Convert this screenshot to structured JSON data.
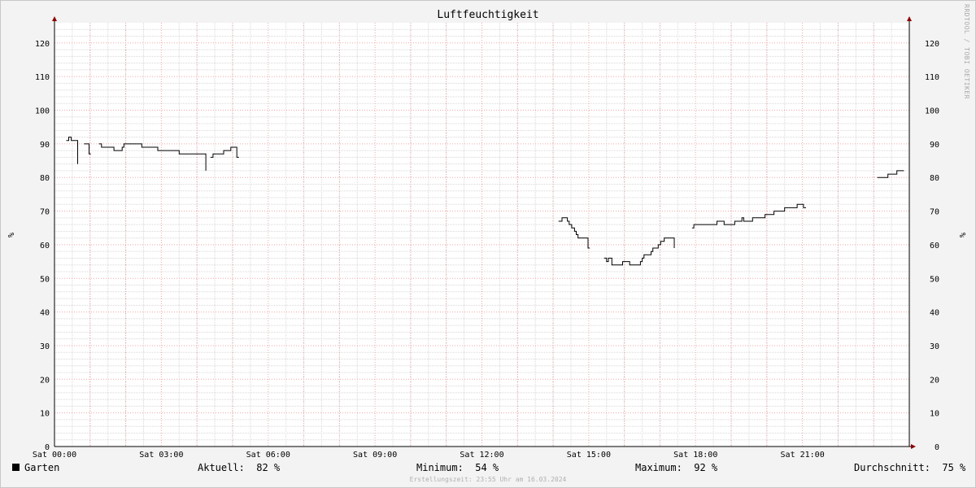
{
  "chart_data": {
    "type": "line",
    "title": "Luftfeuchtigkeit",
    "ylabel": "%",
    "ylim": [
      0,
      126
    ],
    "y_ticks": [
      0,
      10,
      20,
      30,
      40,
      50,
      60,
      70,
      80,
      90,
      100,
      110,
      120
    ],
    "x_range_hours": [
      0,
      24
    ],
    "x_ticks": [
      {
        "hour": 0,
        "label": "Sat 00:00"
      },
      {
        "hour": 3,
        "label": "Sat 03:00"
      },
      {
        "hour": 6,
        "label": "Sat 06:00"
      },
      {
        "hour": 9,
        "label": "Sat 09:00"
      },
      {
        "hour": 12,
        "label": "Sat 12:00"
      },
      {
        "hour": 15,
        "label": "Sat 15:00"
      },
      {
        "hour": 18,
        "label": "Sat 18:00"
      },
      {
        "hour": 21,
        "label": "Sat 21:00"
      }
    ],
    "grid": true,
    "series": [
      {
        "name": "Garten",
        "color": "#000000",
        "segments": [
          [
            [
              0.33,
              91
            ],
            [
              0.4,
              92
            ],
            [
              0.47,
              91
            ],
            [
              0.6,
              91
            ],
            [
              0.65,
              84
            ]
          ],
          [
            [
              0.83,
              90
            ],
            [
              0.93,
              90
            ],
            [
              0.97,
              87
            ],
            [
              1.02,
              87
            ]
          ],
          [
            [
              1.25,
              90
            ],
            [
              1.32,
              89
            ],
            [
              1.62,
              89
            ],
            [
              1.67,
              88
            ],
            [
              1.83,
              88
            ],
            [
              1.9,
              89
            ],
            [
              1.95,
              90
            ],
            [
              2.4,
              90
            ],
            [
              2.45,
              89
            ],
            [
              2.85,
              89
            ],
            [
              2.9,
              88
            ],
            [
              3.4,
              88
            ],
            [
              3.5,
              87
            ],
            [
              4.0,
              87
            ],
            [
              4.22,
              87
            ],
            [
              4.25,
              82
            ]
          ],
          [
            [
              4.38,
              86
            ],
            [
              4.45,
              87
            ],
            [
              4.7,
              87
            ],
            [
              4.75,
              88
            ],
            [
              4.9,
              88
            ],
            [
              4.95,
              89
            ],
            [
              5.05,
              89
            ],
            [
              5.12,
              86
            ],
            [
              5.18,
              86
            ]
          ],
          [
            [
              14.15,
              67
            ],
            [
              14.25,
              68
            ],
            [
              14.33,
              68
            ],
            [
              14.4,
              67
            ],
            [
              14.45,
              66
            ],
            [
              14.52,
              65
            ],
            [
              14.6,
              64
            ],
            [
              14.65,
              63
            ],
            [
              14.7,
              62
            ],
            [
              14.95,
              62
            ],
            [
              14.98,
              59
            ],
            [
              15.03,
              59
            ]
          ],
          [
            [
              15.43,
              56
            ],
            [
              15.5,
              55
            ],
            [
              15.55,
              56
            ],
            [
              15.62,
              56
            ],
            [
              15.65,
              54
            ],
            [
              15.75,
              54
            ],
            [
              15.85,
              54
            ],
            [
              15.95,
              55
            ],
            [
              16.1,
              55
            ],
            [
              16.15,
              54
            ],
            [
              16.35,
              54
            ],
            [
              16.45,
              55
            ],
            [
              16.5,
              56
            ],
            [
              16.55,
              57
            ],
            [
              16.7,
              57
            ],
            [
              16.75,
              58
            ],
            [
              16.8,
              59
            ],
            [
              16.9,
              59
            ],
            [
              16.95,
              60
            ],
            [
              17.02,
              61
            ],
            [
              17.12,
              62
            ],
            [
              17.38,
              62
            ],
            [
              17.4,
              59
            ]
          ],
          [
            [
              17.9,
              65
            ],
            [
              17.95,
              66
            ],
            [
              18.55,
              66
            ],
            [
              18.6,
              67
            ],
            [
              18.75,
              67
            ],
            [
              18.8,
              66
            ],
            [
              19.05,
              66
            ],
            [
              19.1,
              67
            ],
            [
              19.25,
              67
            ],
            [
              19.3,
              68
            ],
            [
              19.35,
              67
            ],
            [
              19.55,
              67
            ],
            [
              19.6,
              68
            ],
            [
              19.9,
              68
            ],
            [
              19.95,
              69
            ],
            [
              20.15,
              69
            ],
            [
              20.2,
              70
            ],
            [
              20.45,
              70
            ],
            [
              20.5,
              71
            ],
            [
              20.8,
              71
            ],
            [
              20.85,
              72
            ],
            [
              20.98,
              72
            ],
            [
              21.03,
              71
            ],
            [
              21.1,
              71
            ]
          ],
          [
            [
              23.1,
              80
            ],
            [
              23.35,
              80
            ],
            [
              23.4,
              81
            ],
            [
              23.6,
              81
            ],
            [
              23.65,
              82
            ],
            [
              23.85,
              82
            ]
          ]
        ]
      }
    ]
  },
  "legend": {
    "series_name": "Garten",
    "aktuell": "Aktuell:  82 %",
    "minimum": "Minimum:  54 %",
    "maximum": "Maximum:  92 %",
    "durchschnitt": "Durchschnitt:  75 %"
  },
  "watermark": "RRDTOOL / TOBI OETIKER",
  "footer": "Erstellungszeit: 23:55 Uhr am 16.03.2024",
  "colors": {
    "background": "#f3f3f3",
    "plot_background": "#ffffff",
    "minor_grid": "#d8d8d8",
    "major_grid": "#f0a8a8",
    "axis": "#000000",
    "arrow": "#8b0000",
    "line": "#000000"
  }
}
